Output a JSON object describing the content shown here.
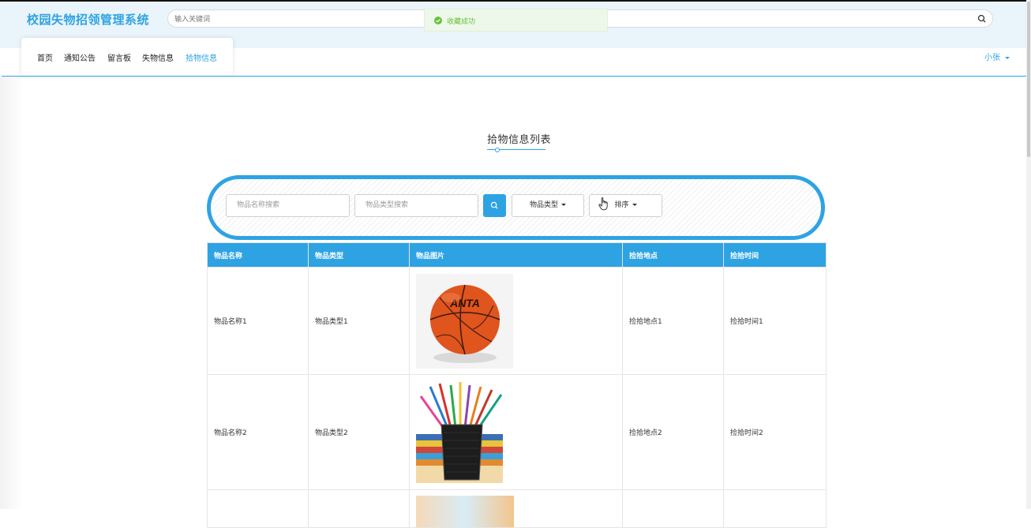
{
  "app": {
    "title": "校园失物招领管理系统"
  },
  "search": {
    "placeholder": "输入关键词"
  },
  "toast": {
    "message": "收藏成功"
  },
  "nav": {
    "items": [
      {
        "label": "首页"
      },
      {
        "label": "通知公告"
      },
      {
        "label": "留言板"
      },
      {
        "label": "失物信息"
      },
      {
        "label": "拾物信息"
      }
    ]
  },
  "user": {
    "name": "小张"
  },
  "page": {
    "title": "拾物信息列表"
  },
  "filters": {
    "name_placeholder": "物品名称搜索",
    "type_placeholder": "物品类型搜索",
    "type_dropdown": "物品类型",
    "sort_dropdown": "排序"
  },
  "table": {
    "headers": [
      "物品名称",
      "物品类型",
      "物品图片",
      "捡拾地点",
      "捡拾时间"
    ],
    "rows": [
      {
        "name": "物品名称1",
        "type": "物品类型1",
        "image": "basketball",
        "place": "捡拾地点1",
        "time": "捡拾时间1"
      },
      {
        "name": "物品名称2",
        "type": "物品类型2",
        "image": "pencil-cup",
        "place": "捡拾地点2",
        "time": "捡拾时间2"
      }
    ]
  },
  "colors": {
    "accent": "#2ea3e3",
    "success": "#67c23a",
    "header_bg": "#eaf4fb"
  }
}
